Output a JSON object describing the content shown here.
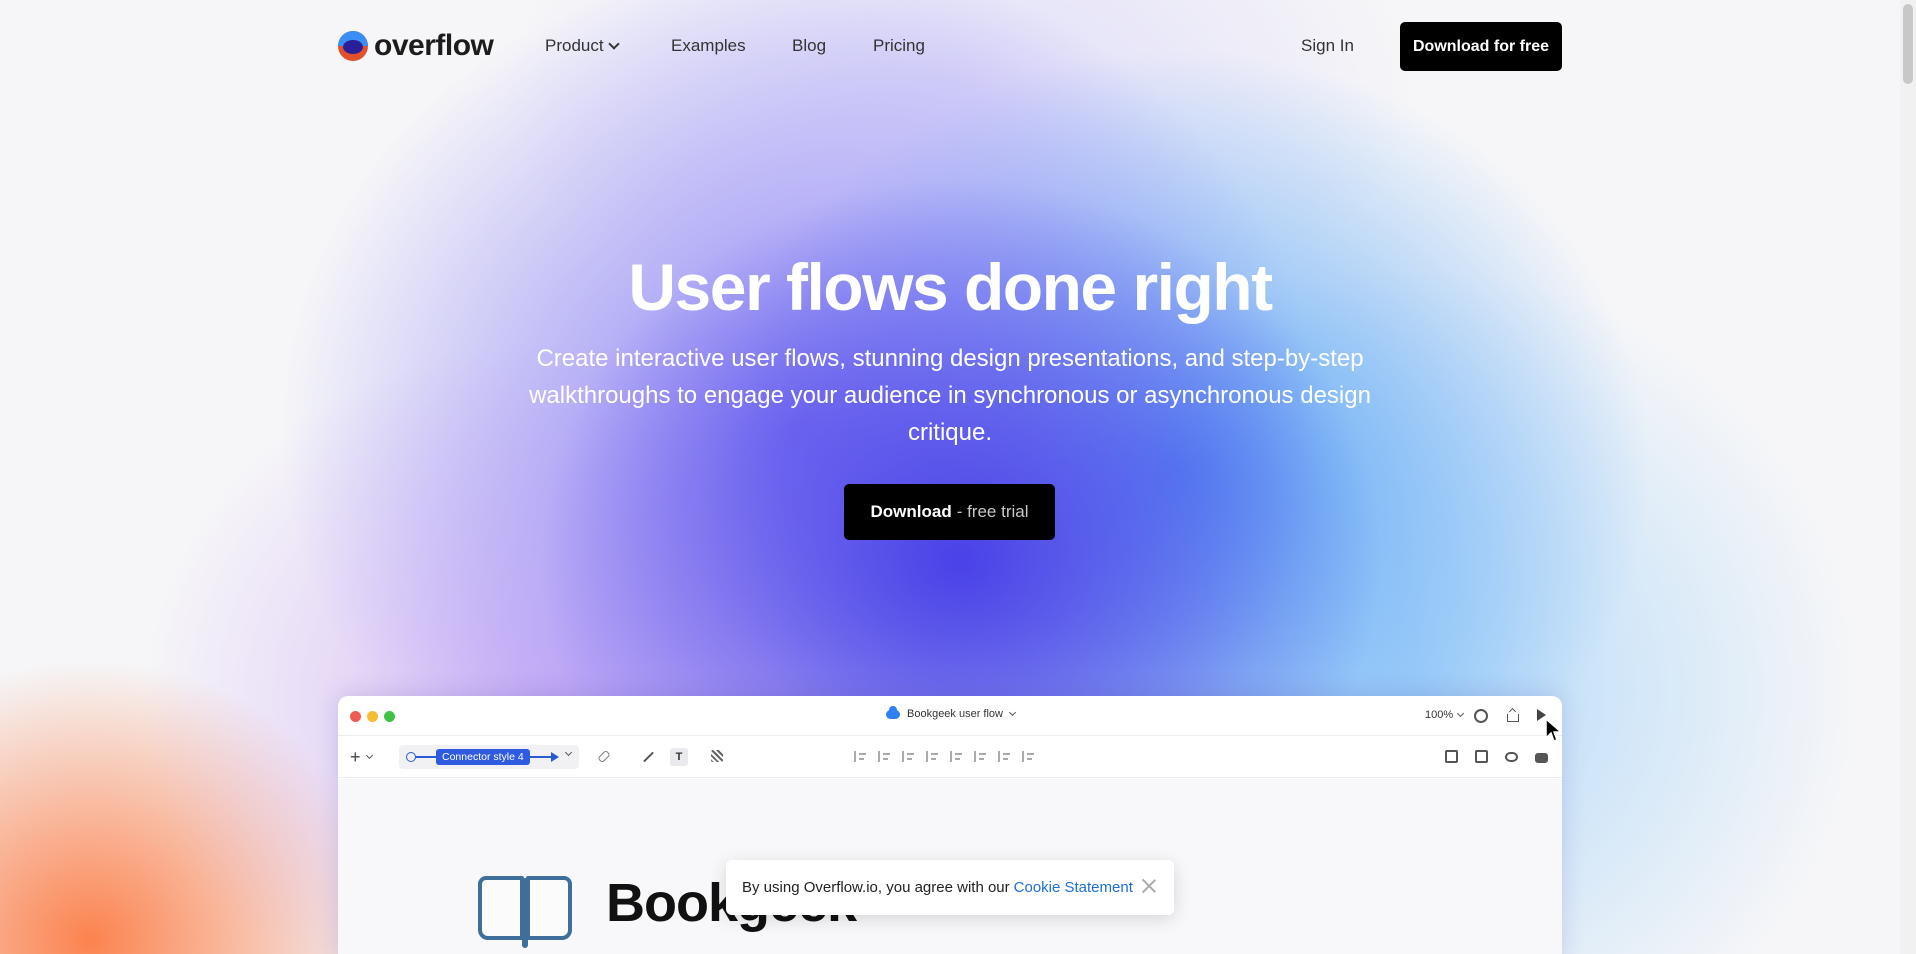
{
  "nav": {
    "logo_text": "overflow",
    "links": [
      "Product",
      "Examples",
      "Blog",
      "Pricing"
    ],
    "sign_in": "Sign In",
    "download_button": "Download for free"
  },
  "hero": {
    "title": "User flows done right",
    "subtitle": "Create interactive user flows, stunning design presentations, and step-by-step walkthroughs to engage your audience in synchronous or asynchronous design critique.",
    "cta_bold": "Download",
    "cta_light": "- free trial"
  },
  "app_window": {
    "doc_title": "Bookgeek user flow",
    "zoom": "100%",
    "connector_label": "Connector style 4",
    "text_tool": "T",
    "canvas_brand": "Bookgeek"
  },
  "cookie": {
    "text": "By using Overflow.io, you agree with our",
    "link": "Cookie Statement"
  },
  "colors": {
    "hero_purple": "#4B3FE8",
    "hero_blue": "#3C96F5",
    "accent_orange": "#FC7D46",
    "button_black": "#000000",
    "link_blue": "#1A6FD8"
  },
  "icons": [
    "logo-icon",
    "chevron-down-icon",
    "cloud-icon",
    "avatar-icon",
    "share-icon",
    "play-icon",
    "plus-icon",
    "link-icon",
    "pen-icon",
    "text-icon",
    "pattern-icon",
    "align-icon",
    "layers-icon",
    "eye-icon",
    "lock-icon",
    "close-icon",
    "book-icon",
    "cursor-icon"
  ]
}
